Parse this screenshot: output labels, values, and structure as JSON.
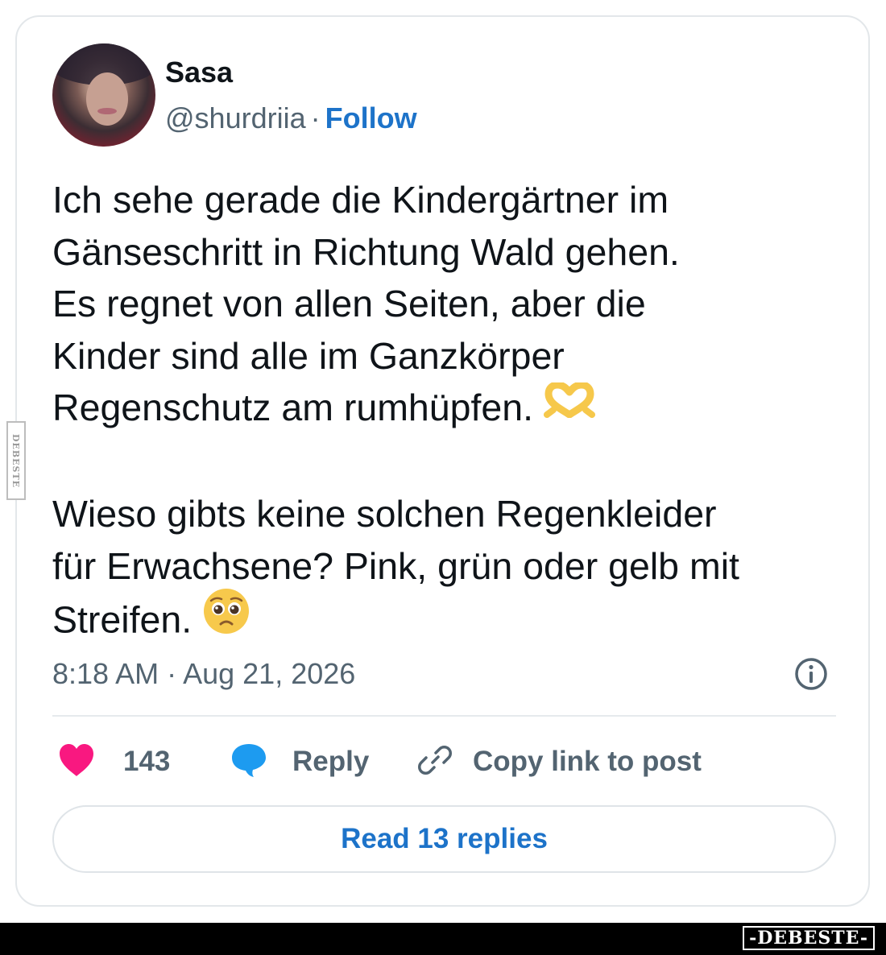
{
  "post": {
    "author_name": "Sasa",
    "handle": "@shurdriia",
    "separator": "·",
    "follow_label": "Follow",
    "text_part1": "Ich sehe gerade die Kindergärtner im\nGänseschritt in Richtung Wald gehen.\nEs regnet von allen Seiten, aber die\nKinder sind alle im Ganzkörper\nRegenschutz am rumhüpfen. ",
    "text_part2": "\n\nWieso gibts keine solchen Regenkleider\nfür Erwachsene? Pink, grün oder gelb mit\nStreifen. ",
    "emoji_1": "heart-hands-emoji",
    "emoji_2": "pleading-face-emoji",
    "timestamp": "8:18 AM · Aug 21, 2026"
  },
  "actions": {
    "like_count": "143",
    "reply_label": "Reply",
    "copy_label": "Copy link to post",
    "read_replies_label": "Read 13 replies"
  },
  "icons": [
    "info-icon",
    "heart-icon",
    "reply-bubble-icon",
    "link-icon"
  ],
  "colors": {
    "accent_blue": "#1d73c9",
    "heart_pink": "#f91880",
    "reply_blue": "#1d9bf0",
    "muted_text": "#536471"
  },
  "watermarks": {
    "side_label": "DEBESTE",
    "footer_label": "-DEBESTE-"
  }
}
